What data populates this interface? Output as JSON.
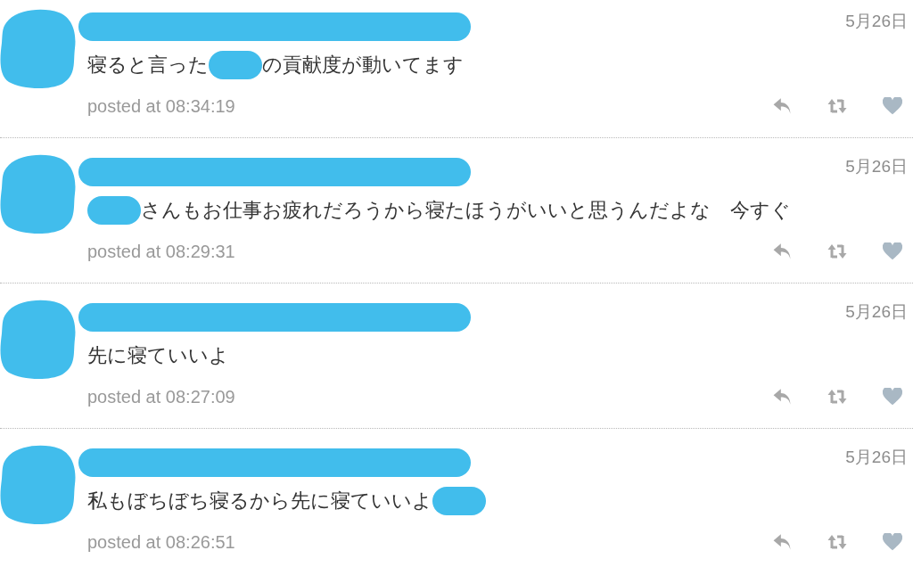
{
  "tweets": [
    {
      "date": "5月26日",
      "text": [
        {
          "kind": "text",
          "value": "寝ると言った"
        },
        {
          "kind": "redacted"
        },
        {
          "kind": "text",
          "value": "の貢献度が動いてます"
        }
      ],
      "posted": "posted at 08:34:19"
    },
    {
      "date": "5月26日",
      "text": [
        {
          "kind": "redacted"
        },
        {
          "kind": "text",
          "value": "さんもお仕事お疲れだろうから寝たほうがいいと思うんだよな　今すぐ"
        }
      ],
      "posted": "posted at 08:29:31"
    },
    {
      "date": "5月26日",
      "text": [
        {
          "kind": "text",
          "value": "先に寝ていいよ"
        }
      ],
      "posted": "posted at 08:27:09"
    },
    {
      "date": "5月26日",
      "text": [
        {
          "kind": "text",
          "value": "私もぼちぼち寝るから先に寝ていいよ"
        },
        {
          "kind": "redacted"
        }
      ],
      "posted": "posted at 08:26:51"
    }
  ]
}
